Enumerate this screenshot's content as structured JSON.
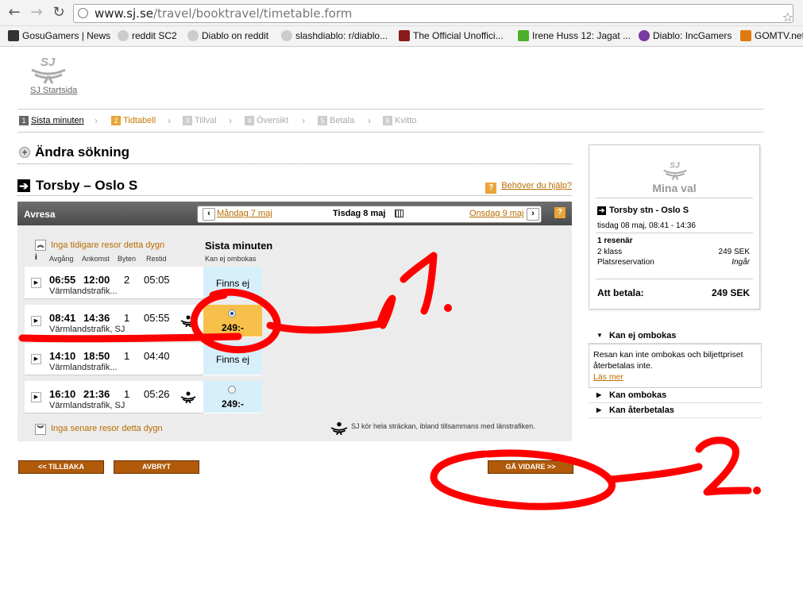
{
  "browser": {
    "url_host": "www.sj.se",
    "url_path": "/travel/booktravel/timetable.form",
    "bookmarks": [
      "GosuGamers | News",
      "reddit SC2",
      "Diablo on reddit",
      "slashdiablo: r/diablo...",
      "The Official Unoffici...",
      "Irene Huss 12: Jagat ...",
      "Diablo: IncGamers",
      "GOMTV.net"
    ]
  },
  "header": {
    "logo_text": "SJ",
    "start_link": "SJ Startsida"
  },
  "steps": [
    {
      "num": "1",
      "label": "Sista minuten"
    },
    {
      "num": "2",
      "label": "Tidtabell"
    },
    {
      "num": "3",
      "label": "Tillval"
    },
    {
      "num": "4",
      "label": "Översikt"
    },
    {
      "num": "5",
      "label": "Betala"
    },
    {
      "num": "6",
      "label": "Kvitto"
    }
  ],
  "search": {
    "change_label": "Ändra sökning"
  },
  "route": {
    "title": "Torsby – Oslo S",
    "help": "Behöver du hjälp?"
  },
  "timetable": {
    "section": "Avresa",
    "prev_day": "Måndag 7 maj",
    "current_day": "Tisdag 8 maj",
    "next_day": "Onsdag 9 maj",
    "earlier": "Inga tidigare resor detta dygn",
    "later": "Inga senare resor detta dygn",
    "info_mark": "i",
    "columns": [
      "Avgång",
      "Ankomst",
      "Byten",
      "Restid"
    ],
    "fare_title": "Sista minuten",
    "fare_sub": "Kan ej ombokas",
    "rows": [
      {
        "dep": "06:55",
        "arr": "12:00",
        "changes": "2",
        "duration": "05:05",
        "operator": "Värmlandstrafik...",
        "fare": "Finns ej"
      },
      {
        "dep": "08:41",
        "arr": "14:36",
        "changes": "1",
        "duration": "05:55",
        "operator": "Värmlandstrafik, SJ",
        "fare": "249:-"
      },
      {
        "dep": "14:10",
        "arr": "18:50",
        "changes": "1",
        "duration": "04:40",
        "operator": "Värmlandstrafik...",
        "fare": "Finns ej"
      },
      {
        "dep": "16:10",
        "arr": "21:36",
        "changes": "1",
        "duration": "05:26",
        "operator": "Värmlandstrafik, SJ",
        "fare": "249:-"
      }
    ],
    "footnote": "SJ kör hela sträckan, ibland tillsammans med länstrafiken."
  },
  "buttons": {
    "back": "<< TILLBAKA",
    "cancel": "AVBRYT",
    "next": "GÅ VIDARE >>"
  },
  "summary": {
    "title": "Mina val",
    "route": "Torsby stn - Oslo S",
    "date": "tisdag 08 maj, 08:41 - 14:36",
    "travellers": "1 resenär",
    "class_label": "2 klass",
    "class_price": "249 SEK",
    "seat_label": "Platsreservation",
    "seat_value": "Ingår",
    "total_label": "Att betala:",
    "total_value": "249 SEK"
  },
  "accordion": {
    "open_title": "Kan ej ombokas",
    "open_body": "Resan kan inte ombokas och biljettpriset återbetalas inte.",
    "read_more": "Läs mer",
    "item2": "Kan ombokas",
    "item3": "Kan återbetalas"
  },
  "annotations": {
    "one": "1.",
    "two": "2."
  },
  "colors": {
    "accent": "#b86d00",
    "selected": "#f7c04a",
    "fare_bg": "#d6effa",
    "scribble": "#ff0000"
  }
}
